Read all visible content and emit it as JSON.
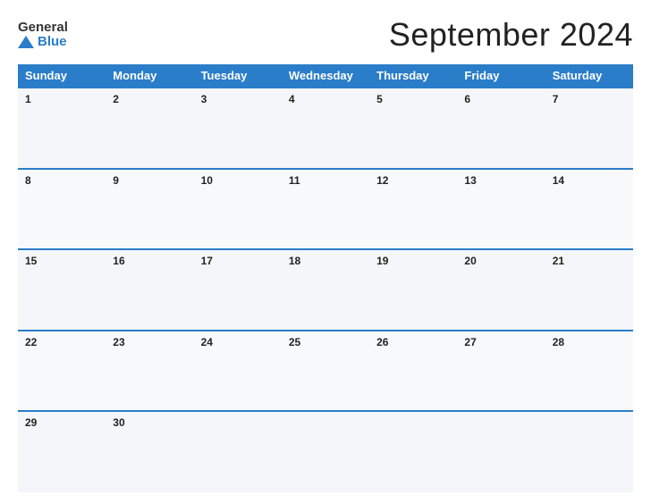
{
  "logo": {
    "general_text": "General",
    "blue_text": "Blue"
  },
  "title": "September 2024",
  "weekdays": [
    "Sunday",
    "Monday",
    "Tuesday",
    "Wednesday",
    "Thursday",
    "Friday",
    "Saturday"
  ],
  "weeks": [
    [
      {
        "day": "1",
        "empty": false
      },
      {
        "day": "2",
        "empty": false
      },
      {
        "day": "3",
        "empty": false
      },
      {
        "day": "4",
        "empty": false
      },
      {
        "day": "5",
        "empty": false
      },
      {
        "day": "6",
        "empty": false
      },
      {
        "day": "7",
        "empty": false
      }
    ],
    [
      {
        "day": "8",
        "empty": false
      },
      {
        "day": "9",
        "empty": false
      },
      {
        "day": "10",
        "empty": false
      },
      {
        "day": "11",
        "empty": false
      },
      {
        "day": "12",
        "empty": false
      },
      {
        "day": "13",
        "empty": false
      },
      {
        "day": "14",
        "empty": false
      }
    ],
    [
      {
        "day": "15",
        "empty": false
      },
      {
        "day": "16",
        "empty": false
      },
      {
        "day": "17",
        "empty": false
      },
      {
        "day": "18",
        "empty": false
      },
      {
        "day": "19",
        "empty": false
      },
      {
        "day": "20",
        "empty": false
      },
      {
        "day": "21",
        "empty": false
      }
    ],
    [
      {
        "day": "22",
        "empty": false
      },
      {
        "day": "23",
        "empty": false
      },
      {
        "day": "24",
        "empty": false
      },
      {
        "day": "25",
        "empty": false
      },
      {
        "day": "26",
        "empty": false
      },
      {
        "day": "27",
        "empty": false
      },
      {
        "day": "28",
        "empty": false
      }
    ],
    [
      {
        "day": "29",
        "empty": false
      },
      {
        "day": "30",
        "empty": false
      },
      {
        "day": "",
        "empty": true
      },
      {
        "day": "",
        "empty": true
      },
      {
        "day": "",
        "empty": true
      },
      {
        "day": "",
        "empty": true
      },
      {
        "day": "",
        "empty": true
      }
    ]
  ]
}
